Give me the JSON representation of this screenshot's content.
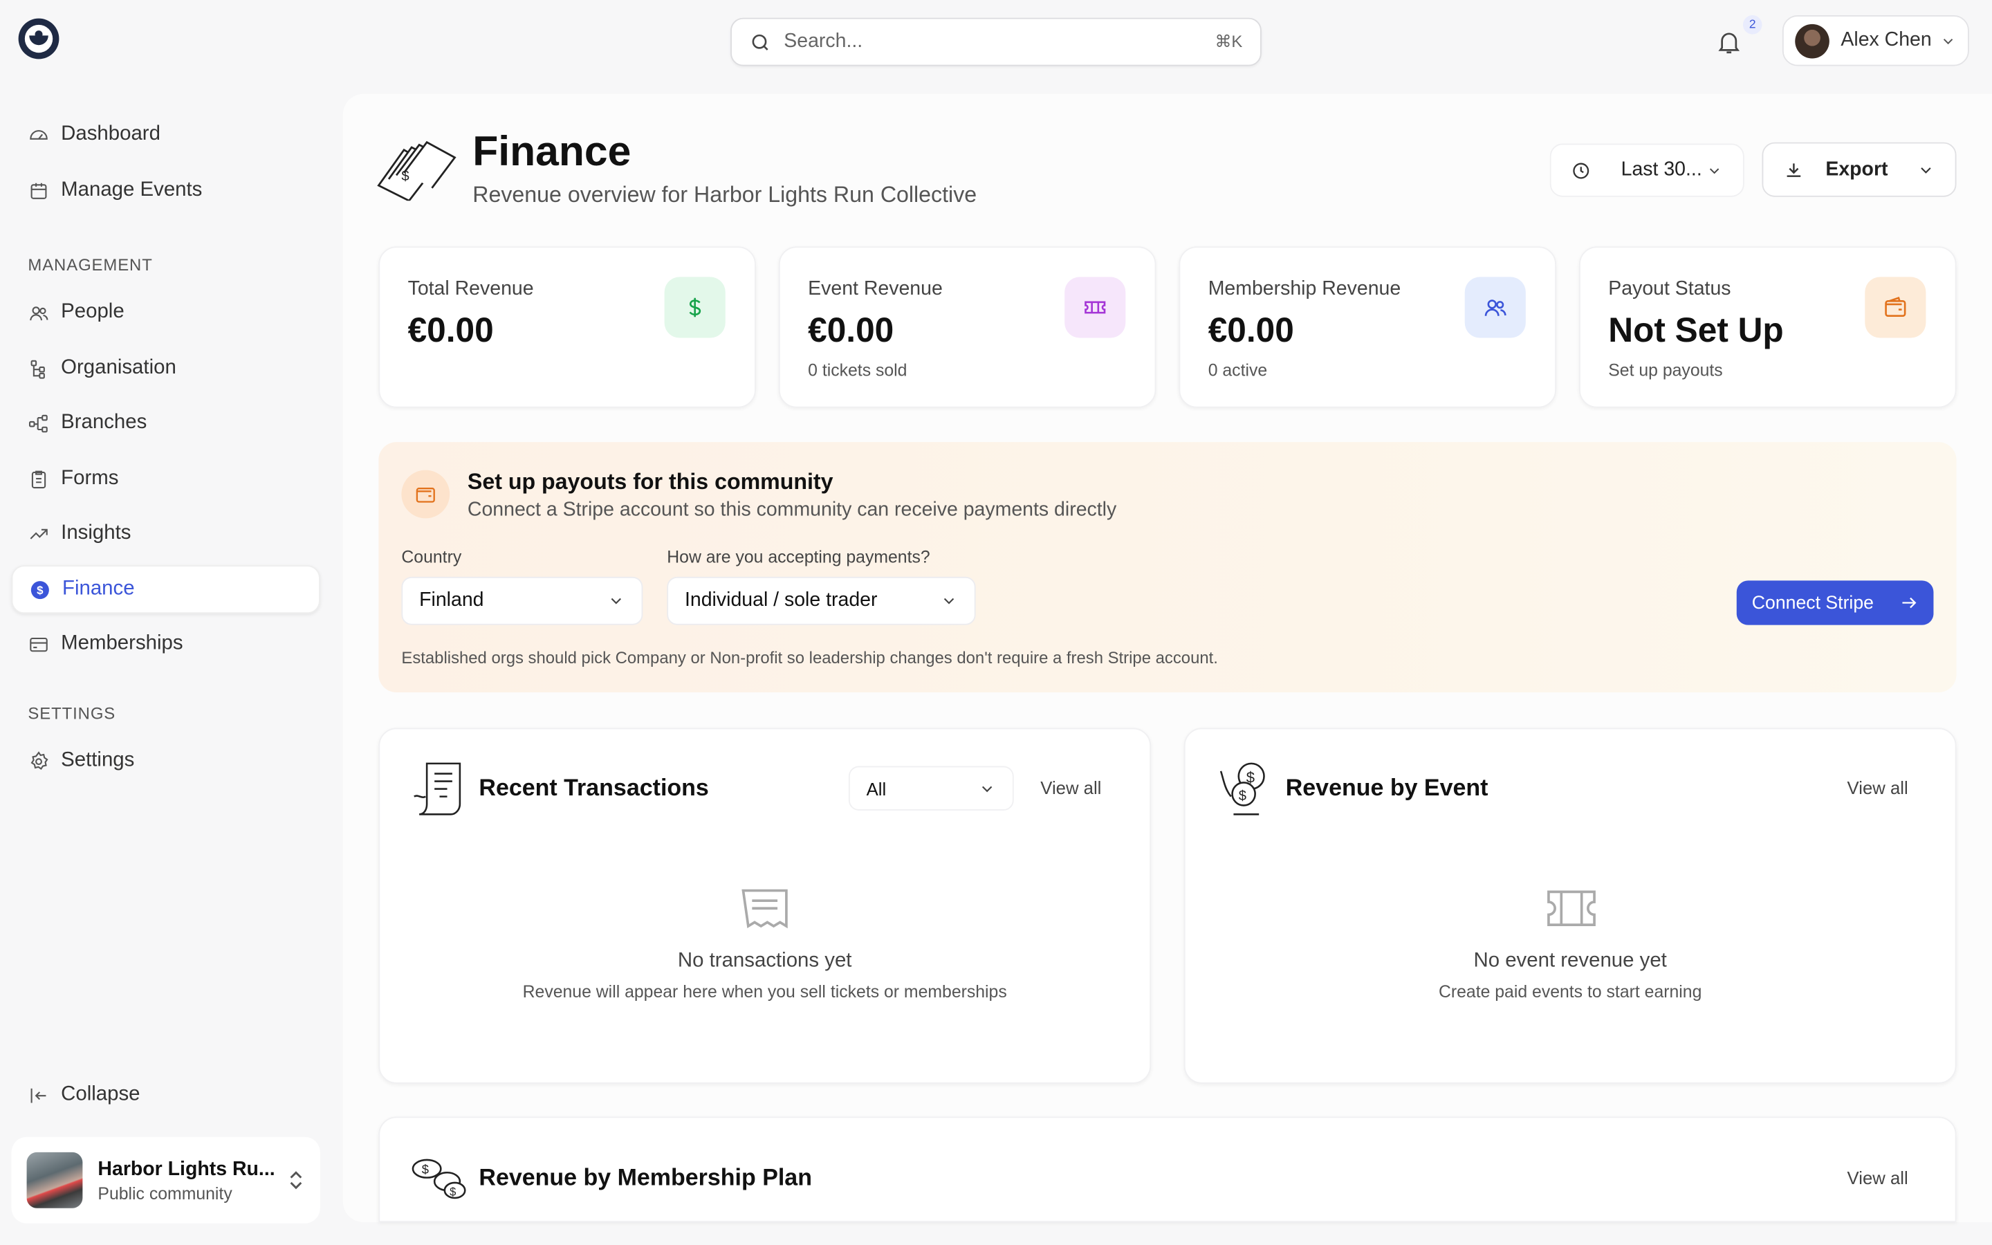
{
  "topbar": {
    "search_placeholder": "Search...",
    "search_shortcut": "⌘K",
    "notification_count": "2",
    "user_name": "Alex Chen"
  },
  "sidebar": {
    "primary": [
      {
        "label": "Dashboard",
        "icon": "gauge-icon"
      },
      {
        "label": "Manage Events",
        "icon": "calendar-icon"
      }
    ],
    "management_heading": "MANAGEMENT",
    "management": [
      {
        "label": "People",
        "icon": "people-icon"
      },
      {
        "label": "Organisation",
        "icon": "org-tree-icon"
      },
      {
        "label": "Branches",
        "icon": "branches-icon"
      },
      {
        "label": "Forms",
        "icon": "clipboard-icon"
      },
      {
        "label": "Insights",
        "icon": "trend-icon"
      },
      {
        "label": "Finance",
        "icon": "dollar-circle-icon",
        "active": true
      },
      {
        "label": "Memberships",
        "icon": "card-icon"
      }
    ],
    "settings_heading": "SETTINGS",
    "settings": [
      {
        "label": "Settings",
        "icon": "gear-icon"
      }
    ],
    "collapse_label": "Collapse",
    "community": {
      "name": "Harbor Lights Ru...",
      "visibility": "Public community"
    }
  },
  "header": {
    "title": "Finance",
    "subtitle": "Revenue overview for Harbor Lights Run Collective",
    "range_label": "Last 30...",
    "export_label": "Export"
  },
  "stats": [
    {
      "label": "Total Revenue",
      "value": "€0.00",
      "sub": "",
      "icon": "dollar-icon",
      "color": "#16a34a",
      "bg": "#e3f8ea"
    },
    {
      "label": "Event Revenue",
      "value": "€0.00",
      "sub": "0 tickets sold",
      "icon": "ticket-icon",
      "color": "#a435d6",
      "bg": "#f6e6fb"
    },
    {
      "label": "Membership Revenue",
      "value": "€0.00",
      "sub": "0 active",
      "icon": "users-icon",
      "color": "#3b55d9",
      "bg": "#e4ecfd"
    },
    {
      "label": "Payout Status",
      "value": "Not Set Up",
      "sub": "Set up payouts",
      "icon": "wallet-icon",
      "color": "#e2721c",
      "bg": "#fdebd8"
    }
  ],
  "payout": {
    "title": "Set up payouts for this community",
    "subtitle": "Connect a Stripe account so this community can receive payments directly",
    "country_label": "Country",
    "country_value": "Finland",
    "method_label": "How are you accepting payments?",
    "method_value": "Individual / sole trader",
    "connect_label": "Connect Stripe",
    "hint": "Established orgs should pick Company or Non-profit so leadership changes don't require a fresh Stripe account."
  },
  "transactions": {
    "title": "Recent Transactions",
    "filter_value": "All",
    "view_all": "View all",
    "empty_title": "No transactions yet",
    "empty_sub": "Revenue will appear here when you sell tickets or memberships"
  },
  "revenue_by_event": {
    "title": "Revenue by Event",
    "view_all": "View all",
    "empty_title": "No event revenue yet",
    "empty_sub": "Create paid events to start earning"
  },
  "revenue_by_plan": {
    "title": "Revenue by Membership Plan",
    "view_all": "View all"
  }
}
